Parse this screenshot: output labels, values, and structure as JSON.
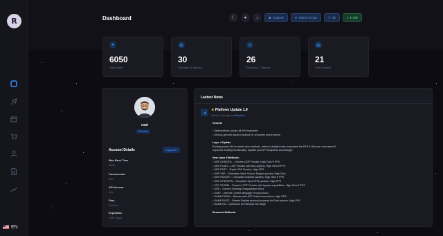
{
  "brand": {
    "logo_text": "R"
  },
  "header": {
    "title": "Dashboard",
    "toolbar": {
      "support_label": "Support",
      "signal_group_label": "Signal Group",
      "count_label": "36",
      "balance_label": "€ 168"
    }
  },
  "language": {
    "code": "EN"
  },
  "stats": [
    {
      "icon": "user-icon",
      "value": "6050",
      "label": "Total Users"
    },
    {
      "icon": "globe-icon",
      "value": "30",
      "label": "Running L4 Attacks"
    },
    {
      "icon": "wifi-icon",
      "value": "26",
      "label": "Running L7 Attacks"
    },
    {
      "icon": "server-icon",
      "value": "21",
      "label": "Total Servers"
    }
  ],
  "profile": {
    "username": "root",
    "role": "Premium",
    "account_title": "Account Details",
    "upgrade_label": "Upgrade",
    "details": [
      {
        "label": "Max Boot Time",
        "value": "3600"
      },
      {
        "label": "Concurrents",
        "value": "500"
      },
      {
        "label": "API Access",
        "value": "Yes"
      },
      {
        "label": "Plan",
        "value": "Custom"
      },
      {
        "label": "Expiration",
        "value": "2957 Days"
      }
    ]
  },
  "news": {
    "title": "Lastest News",
    "item": {
      "title": "Platform Update 1.9",
      "meta_prefix": "Added 4 days ago by",
      "author": "Rebellion",
      "lines": [
        {
          "text": "General",
          "bold": true
        },
        {
          "text": "",
          "bold": false
        },
        {
          "text": "• Optimizations across all API endpoints!",
          "bold": false
        },
        {
          "text": "• Various general issues resolved for smoother performance.",
          "bold": false
        },
        {
          "text": "",
          "bold": false
        },
        {
          "text": "Layer 4 Update",
          "bold": true
        },
        {
          "text": "Exciting news! We've added new methods, retired outdated ones, increased the PPS € Gb/s per concurrent €",
          "bold": false
        },
        {
          "text": "improved existing functionality. Update your API endpoints accordingly!",
          "bold": false
        },
        {
          "text": "",
          "bold": false
        },
        {
          "text": "New Layer 4 Methods:",
          "bold": true
        },
        {
          "text": "• UDP-GENERIC – Generic UDP Flooder, High Gb/s € PPS",
          "bold": false
        },
        {
          "text": "• UDP-PLAIN – UDP Flooder with less options, High Gb/s € PPS",
          "bold": false
        },
        {
          "text": "• UDP-FAST – Rapid UDP Flooder, High PPS",
          "bold": false
        },
        {
          "text": "• UDP-VSE – Simulates Valve Source Engine queries, High Gb/s",
          "bold": false
        },
        {
          "text": "• UDP-RAKNET – Simulates RakNet packets, High Gb/s € PPS",
          "bold": false
        },
        {
          "text": "• UDP-OPENVPN – Simulates OpenVPN packets, High PPS",
          "bold": false
        },
        {
          "text": "• TCP-STORM – Powerful TCP Flooder with bypass capabilities, High Gb/s € PPS",
          "bold": false
        },
        {
          "text": "• GRE – Generic Routing Encapsulation flood",
          "bold": false
        },
        {
          "text": "• ICMP – Internet Control Message Protocol flood",
          "bold": false
        },
        {
          "text": "• GAME-FIVEM – Bleeds real UDP FiveM connections, High PPS",
          "bold": false
        },
        {
          "text": "• GAME-RUST – Bleeds RakNet protocol property for Rust servers, High PPS",
          "bold": false
        },
        {
          "text": "• GAME-R6 – Optimized for Rainbow Six Siege",
          "bold": false
        },
        {
          "text": "",
          "bold": false
        },
        {
          "text": "Removed Methods:",
          "bold": true
        }
      ]
    }
  },
  "colors": {
    "accent": "#3a8dff",
    "success": "#5fe08f",
    "background": "#0c0c12",
    "card": "#1a1b22"
  }
}
